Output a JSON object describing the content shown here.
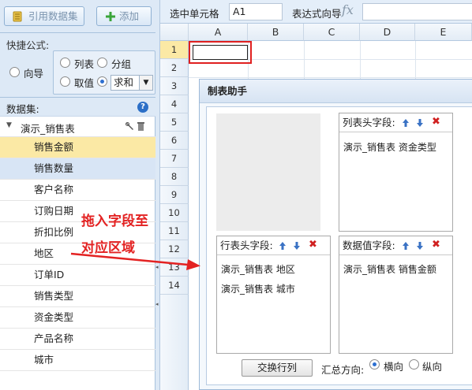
{
  "toolbar": {
    "ref_dataset": "引用数据集",
    "add": "添加"
  },
  "quick_formula": {
    "label": "快捷公式:",
    "options": [
      "向导",
      "列表",
      "分组",
      "取值",
      "求和"
    ],
    "selected": "求和"
  },
  "dataset": {
    "label": "数据集:",
    "name": "演示_销售表",
    "fields": [
      "销售金额",
      "销售数量",
      "客户名称",
      "订购日期",
      "折扣比例",
      "地区",
      "订单ID",
      "销售类型",
      "资金类型",
      "产品名称",
      "城市"
    ]
  },
  "cell_bar": {
    "selected_label": "选中单元格",
    "selected_value": "A1",
    "expr_label": "表达式向导",
    "fx": "fx"
  },
  "grid": {
    "columns": [
      "A",
      "B",
      "C",
      "D",
      "E"
    ],
    "rows": [
      "1",
      "2",
      "3",
      "4",
      "5",
      "6",
      "7",
      "8",
      "9",
      "10",
      "11",
      "12",
      "13",
      "14"
    ]
  },
  "dialog": {
    "title": "制表助手",
    "column_header": {
      "label": "列表头字段:",
      "items": [
        "演示_销售表  资金类型"
      ]
    },
    "row_header": {
      "label": "行表头字段:",
      "items": [
        "演示_销售表  地区",
        "演示_销售表  城市"
      ]
    },
    "value_field": {
      "label": "数据值字段:",
      "items": [
        "演示_销售表  销售金额"
      ]
    },
    "swap_button": "交换行列",
    "summary_label": "汇总方向:",
    "directions": [
      "横向",
      "纵向"
    ],
    "direction_selected": "横向"
  },
  "annotation": {
    "line1": "拖入字段至",
    "line2": "对应区域"
  },
  "colors": {
    "accent": "#2d6fd1",
    "highlight": "#fbe9a5",
    "annotation": "#e32222"
  }
}
